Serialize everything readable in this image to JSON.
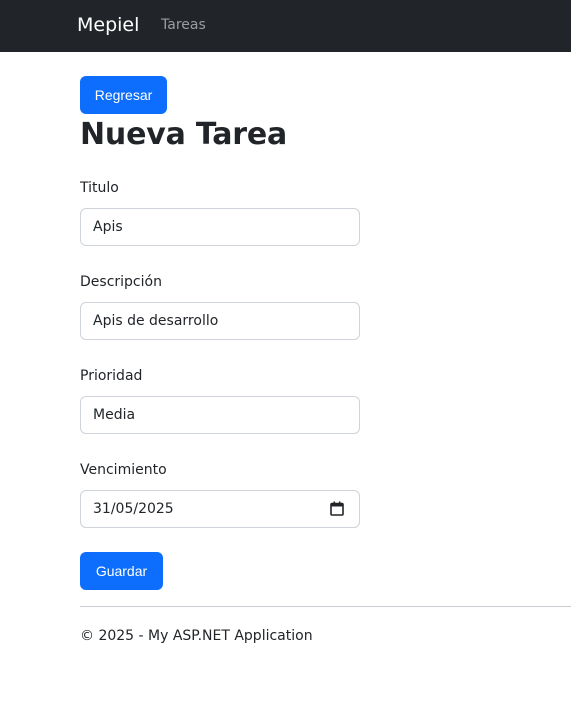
{
  "navbar": {
    "brand": "Mepiel",
    "links": [
      {
        "label": "Tareas"
      }
    ]
  },
  "buttons": {
    "back_label": "Regresar",
    "save_label": "Guardar"
  },
  "page": {
    "title": "Nueva Tarea"
  },
  "form": {
    "fields": [
      {
        "label": "Titulo",
        "value": "Apis"
      },
      {
        "label": "Descripción",
        "value": "Apis de desarrollo"
      },
      {
        "label": "Prioridad",
        "value": "Media"
      },
      {
        "label": "Vencimiento",
        "value": "31/05/2025",
        "icon": "calendar-icon"
      }
    ]
  },
  "footer": {
    "text": "© 2025 - My ASP.NET Application"
  },
  "colors": {
    "navbar_bg": "#212529",
    "primary": "#0d6efd",
    "nav_link": "#9a9da0",
    "input_border": "#ced4da"
  }
}
